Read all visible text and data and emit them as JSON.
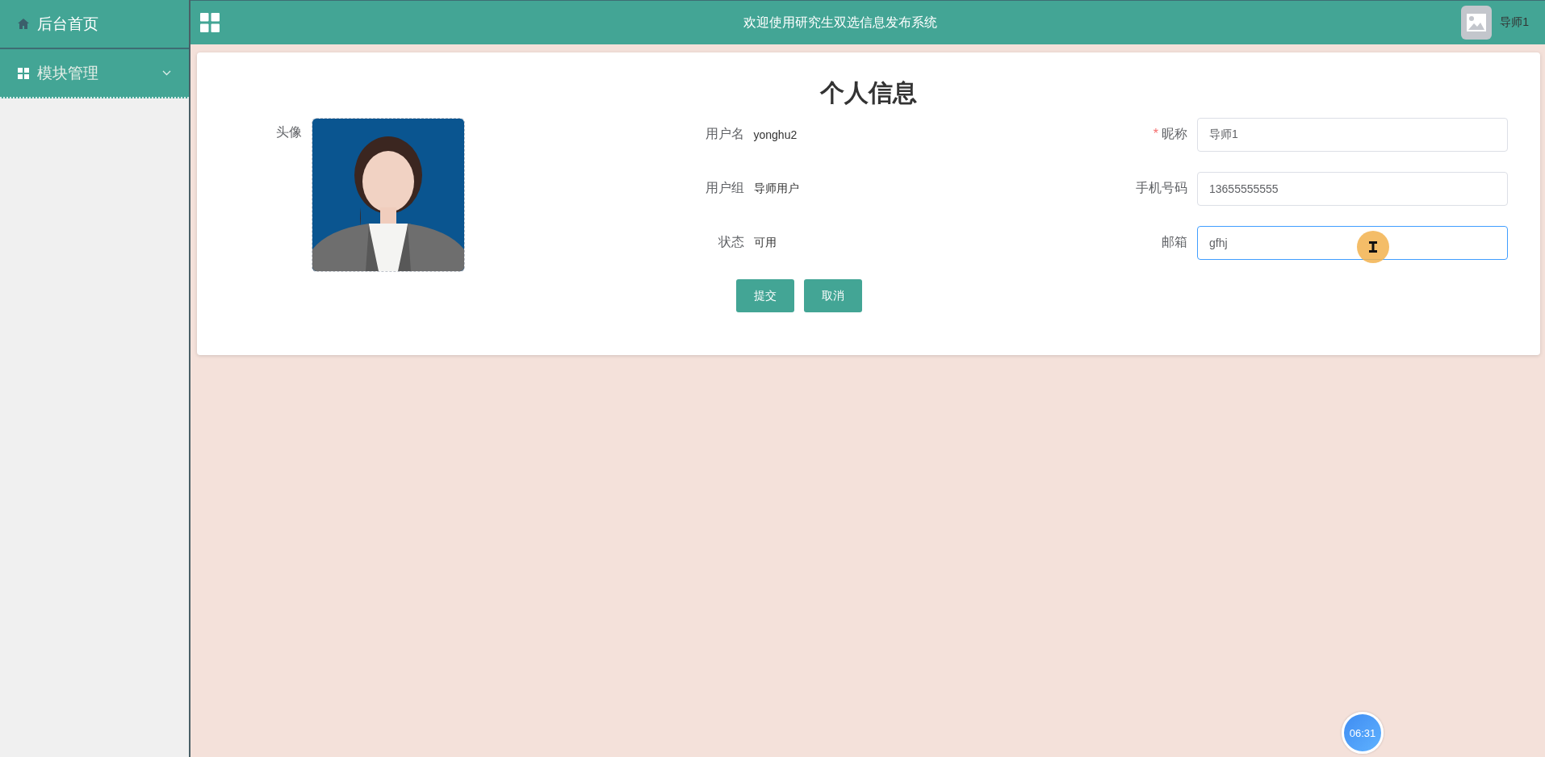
{
  "sidebar": {
    "items": [
      {
        "label": "后台首页",
        "has_submenu": false
      },
      {
        "label": "模块管理",
        "has_submenu": true
      }
    ]
  },
  "header": {
    "title": "欢迎使用研究生双选信息发布系统",
    "user_name": "导师1"
  },
  "profile": {
    "title": "个人信息",
    "avatar_label": "头像",
    "avatar": {
      "kind": "picture"
    },
    "info": [
      {
        "label": "用户名",
        "value": "yonghu2"
      },
      {
        "label": "用户组",
        "value": "导师用户"
      },
      {
        "label": "状态",
        "value": "可用"
      }
    ],
    "fields": [
      {
        "label": "昵称",
        "value": "导师1",
        "required_mark": "*",
        "focused": false
      },
      {
        "label": "手机号码",
        "value": "13655555555",
        "focused": false
      },
      {
        "label": "邮箱",
        "value": "gfhj",
        "focused": true
      }
    ],
    "buttons": [
      "提交",
      "取消"
    ]
  },
  "timer": "06:31"
}
